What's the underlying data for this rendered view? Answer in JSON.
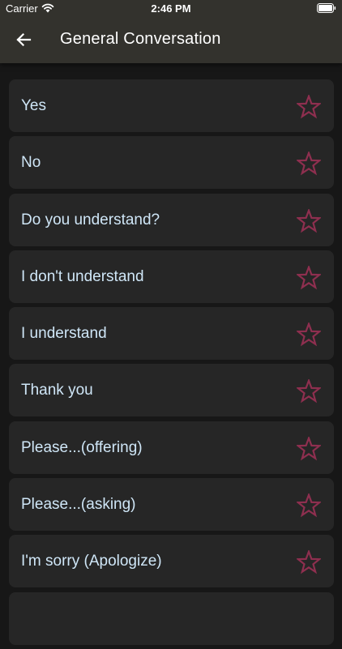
{
  "status_bar": {
    "carrier": "Carrier",
    "time": "2:46 PM",
    "icons": [
      "wifi-icon",
      "battery-icon"
    ]
  },
  "header": {
    "title": "General Conversation",
    "back_icon": "back-arrow-icon"
  },
  "colors": {
    "header_bg": "#33322d",
    "page_bg": "#171717",
    "card_bg": "#262626",
    "text": "#cfe6f7",
    "star_outline": "#8e2f4f"
  },
  "phrases": [
    {
      "label": "Yes"
    },
    {
      "label": "No"
    },
    {
      "label": "Do you understand?"
    },
    {
      "label": "I don't understand"
    },
    {
      "label": "I understand"
    },
    {
      "label": "Thank you"
    },
    {
      "label": "Please...(offering)"
    },
    {
      "label": "Please...(asking)"
    },
    {
      "label": "I'm sorry (Apologize)"
    },
    {
      "label": ""
    }
  ]
}
